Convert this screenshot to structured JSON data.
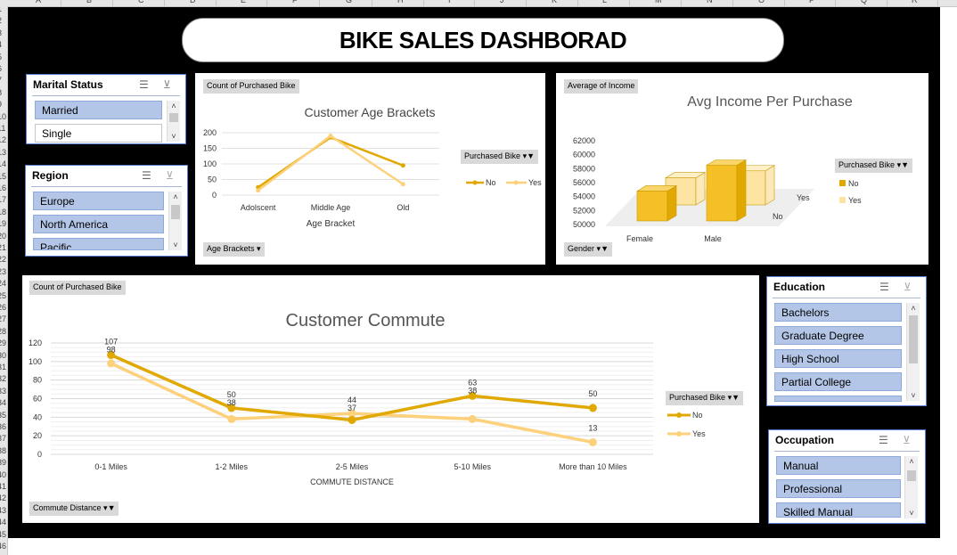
{
  "sheet": {
    "columns": [
      "A",
      "B",
      "C",
      "D",
      "E",
      "F",
      "G",
      "H",
      "I",
      "J",
      "K",
      "L",
      "M",
      "N",
      "O",
      "P",
      "Q",
      "R"
    ],
    "rows": [
      "1",
      "2",
      "3",
      "4",
      "5",
      "6",
      "7",
      "8",
      "9",
      "10",
      "11",
      "12",
      "13",
      "14",
      "15",
      "16",
      "17",
      "18",
      "19",
      "20",
      "21",
      "22",
      "23",
      "24",
      "25",
      "26",
      "27",
      "28",
      "29",
      "30",
      "31",
      "32",
      "33",
      "34",
      "35",
      "36",
      "37",
      "38",
      "39",
      "40",
      "41",
      "42",
      "43",
      "44",
      "45",
      "46"
    ]
  },
  "dashboard": {
    "title": "BIKE SALES DASHBORAD"
  },
  "slicers": {
    "marital": {
      "title": "Marital Status",
      "items": [
        "Married",
        "Single"
      ]
    },
    "region": {
      "title": "Region",
      "items": [
        "Europe",
        "North America",
        "Pacific"
      ]
    },
    "education": {
      "title": "Education",
      "items": [
        "Bachelors",
        "Graduate Degree",
        "High School",
        "Partial College"
      ]
    },
    "occupation": {
      "title": "Occupation",
      "items": [
        "Manual",
        "Professional",
        "Skilled Manual"
      ]
    }
  },
  "colors": {
    "no": "#e0a800",
    "yes": "#fdd17c"
  },
  "icons": {
    "multi_select": "multi-select-icon",
    "clear_filter": "clear-filter-icon",
    "filter_dropdown": "filter-dropdown-icon"
  },
  "chart_data": [
    {
      "type": "line",
      "title": "Customer Age Brackets",
      "field_button": "Count of Purchased Bike",
      "axis_button": "Age Brackets",
      "legend_title": "Purchased Bike",
      "legend_position": "right",
      "categories": [
        "Adolscent",
        "Middle Age",
        "Old"
      ],
      "xlabel": "Age Bracket",
      "ylabel": "",
      "ylim": [
        0,
        200
      ],
      "yticks": [
        0,
        50,
        100,
        150,
        200
      ],
      "series": [
        {
          "name": "No",
          "values": [
            25,
            185,
            95
          ]
        },
        {
          "name": "Yes",
          "values": [
            15,
            190,
            35
          ]
        }
      ]
    },
    {
      "type": "bar",
      "title": "Avg Income Per Purchase",
      "field_button": "Average of Income",
      "axis_button": "Gender",
      "legend_title": "Purchased Bike",
      "legend_position": "right",
      "categories": [
        "Female",
        "Male"
      ],
      "depth_labels": [
        "No",
        "Yes"
      ],
      "ylim": [
        50000,
        62000
      ],
      "yticks": [
        50000,
        52000,
        54000,
        56000,
        58000,
        60000,
        62000
      ],
      "series": [
        {
          "name": "No",
          "values": [
            55300,
            59000
          ]
        },
        {
          "name": "Yes",
          "values": [
            59500,
            60500
          ]
        }
      ]
    },
    {
      "type": "line",
      "title": "Customer Commute",
      "field_button": "Count of Purchased Bike",
      "axis_button": "Commute Distance",
      "legend_title": "Purchased Bike",
      "legend_position": "right",
      "categories": [
        "0-1 Miles",
        "1-2 Miles",
        "2-5 Miles",
        "5-10 Miles",
        "More than 10 Miles"
      ],
      "xlabel": "COMMUTE DISTANCE",
      "ylabel": "",
      "ylim": [
        0,
        120
      ],
      "yticks": [
        0,
        20,
        40,
        60,
        80,
        100,
        120
      ],
      "series": [
        {
          "name": "No",
          "values": [
            107,
            50,
            37,
            63,
            50
          ]
        },
        {
          "name": "Yes",
          "values": [
            98,
            38,
            44,
            38,
            13
          ]
        }
      ]
    }
  ]
}
